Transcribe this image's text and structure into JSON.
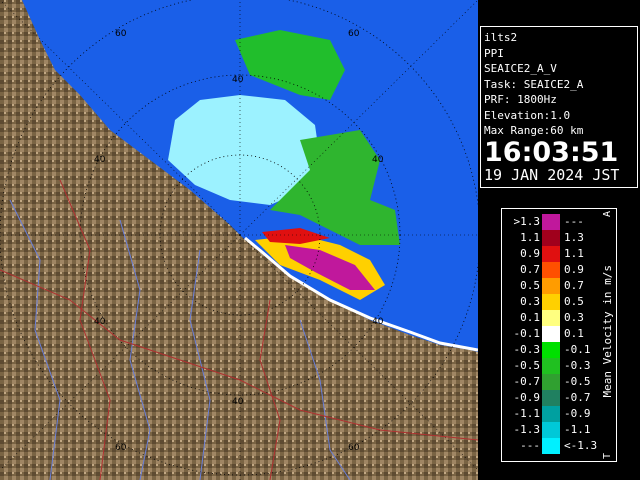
{
  "radar": {
    "range_labels": [
      "60",
      "40",
      "60",
      "40",
      "40",
      "40",
      "40",
      "40",
      "60",
      "60"
    ]
  },
  "info": {
    "site": "ilts2",
    "product": "PPI",
    "scan": "SEAICE2_A_V",
    "task": "Task: SEAICE2_A",
    "prf": "PRF: 1800Hz",
    "elevation": "Elevation:1.0",
    "max_range": "Max Range:60 km",
    "time": "16:03:51",
    "date": "19 JAN 2024 JST"
  },
  "legend": {
    "title": "Mean Velocity in m/s",
    "top_mark": "A",
    "bottom_mark": "T",
    "rows": [
      {
        "lo": ">1.3",
        "hi": "---",
        "color": "#c0189c"
      },
      {
        "lo": "1.1",
        "hi": "1.3",
        "color": "#a0001c"
      },
      {
        "lo": "0.9",
        "hi": "1.1",
        "color": "#e01010"
      },
      {
        "lo": "0.7",
        "hi": "0.9",
        "color": "#ff5000"
      },
      {
        "lo": "0.5",
        "hi": "0.7",
        "color": "#ff9c00"
      },
      {
        "lo": "0.3",
        "hi": "0.5",
        "color": "#ffd000"
      },
      {
        "lo": "0.1",
        "hi": "0.3",
        "color": "#ffff80"
      },
      {
        "lo": "-0.1",
        "hi": "0.1",
        "color": "#ffffff"
      },
      {
        "lo": "-0.3",
        "hi": "-0.1",
        "color": "#00e000"
      },
      {
        "lo": "-0.5",
        "hi": "-0.3",
        "color": "#20c020"
      },
      {
        "lo": "-0.7",
        "hi": "-0.5",
        "color": "#30a030"
      },
      {
        "lo": "-0.9",
        "hi": "-0.7",
        "color": "#208060"
      },
      {
        "lo": "-1.1",
        "hi": "-0.9",
        "color": "#00a0a0"
      },
      {
        "lo": "-1.3",
        "hi": "-1.1",
        "color": "#00c8d8"
      },
      {
        "lo": "---",
        "hi": "<-1.3",
        "color": "#00f0ff"
      }
    ]
  }
}
